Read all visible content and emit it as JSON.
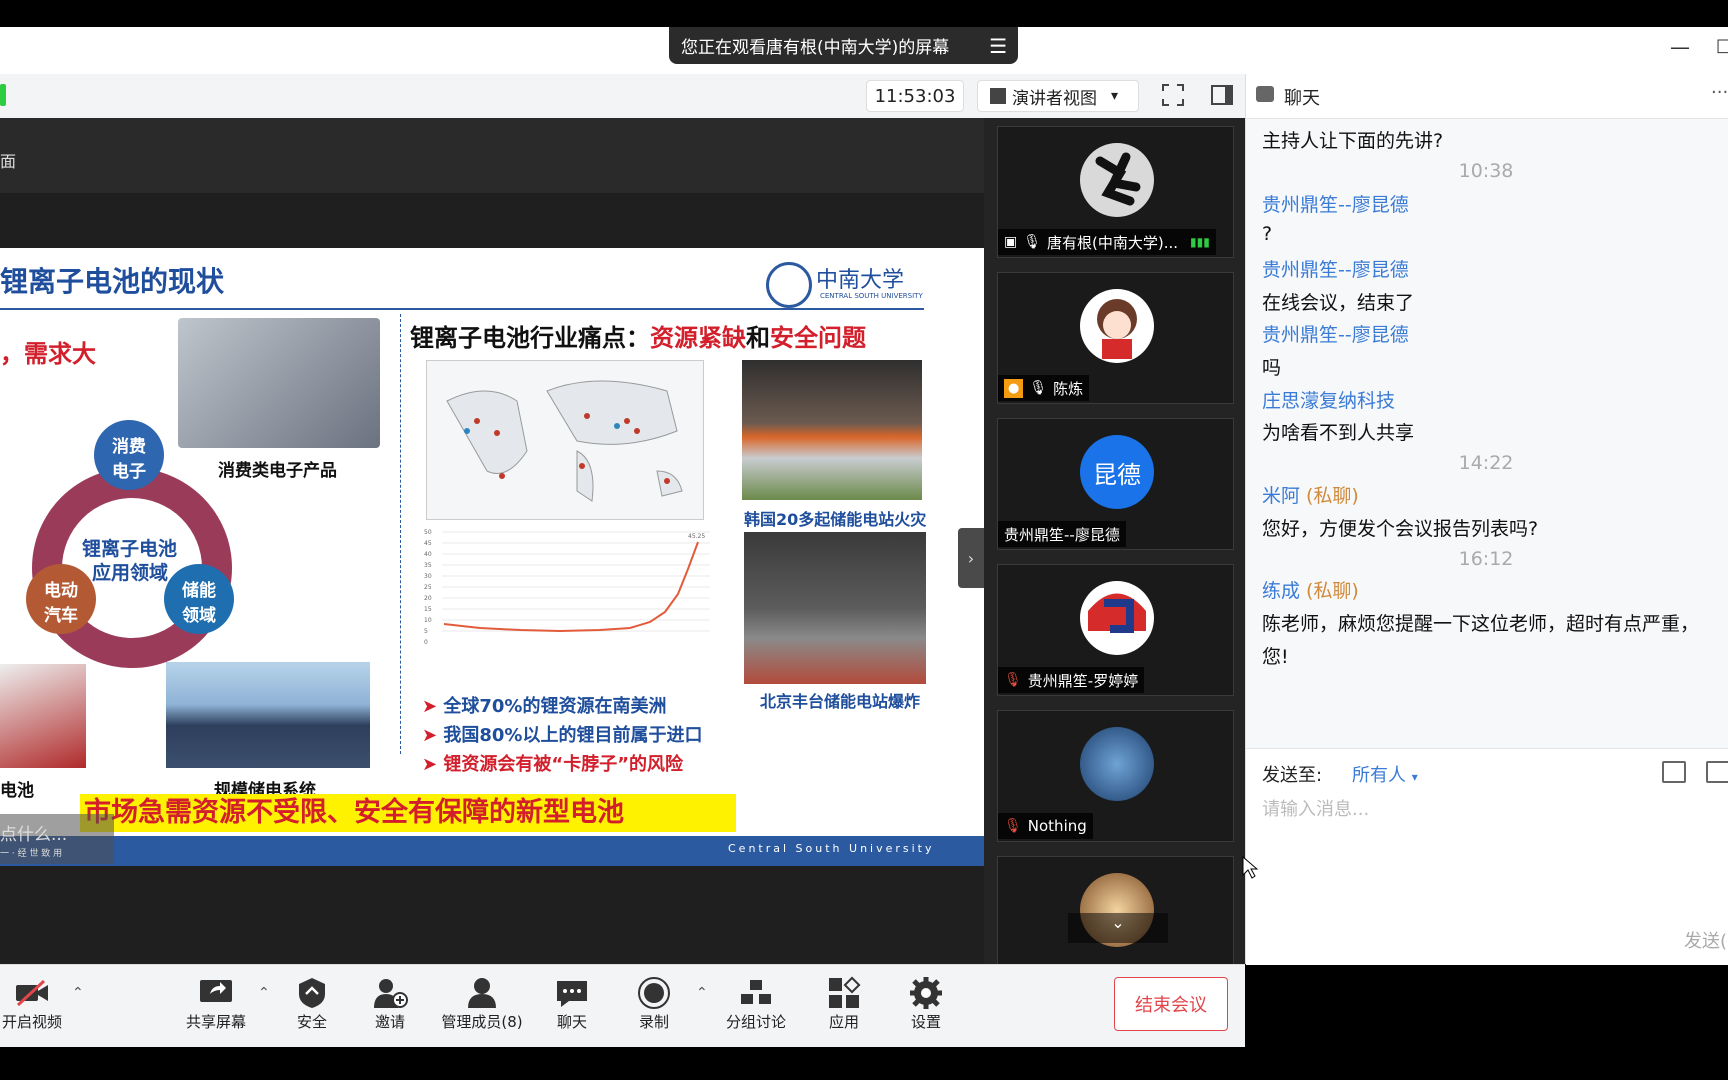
{
  "window": {
    "banner_text": "您正在观看唐有根(中南大学)的屏幕",
    "banner_menu": "☰",
    "minimize": "—",
    "maximize": "□"
  },
  "toolbar": {
    "clock": "11:53:03",
    "view_mode": "演讲者视图",
    "dropdown": "▾"
  },
  "chat_header": {
    "title": "聊天",
    "more": "···"
  },
  "slide": {
    "corner_label": "面",
    "title": "锂离子电池的现状",
    "univ_cn": "中南大学",
    "univ_en": "CENTRAL SOUTH UNIVERSITY",
    "left_sub": "，需求大",
    "consumer_label": "消费类电子产品",
    "circle_center_1": "锂离子电池",
    "circle_center_2": "应用领域",
    "node_consumer_1": "消费",
    "node_consumer_2": "电子",
    "node_ev_1": "电动",
    "node_ev_2": "汽车",
    "node_storage_1": "储能",
    "node_storage_2": "领域",
    "right_heading_prefix": "锂离子电池行业痛点：",
    "right_heading_red1": "资源紧缺",
    "right_heading_mid": "和",
    "right_heading_red2": "安全问题",
    "fire1_caption": "韩国20多起储能电站火灾",
    "fire2_caption": "北京丰台储能电站爆炸",
    "bullets": [
      "全球70%的锂资源在南美洲",
      "我国80%以上的锂目前属于进口",
      "锂资源会有被“卡脖子”的风险"
    ],
    "ev_label": "电池",
    "grid_label": "规模储电系统",
    "banner": "市场急需资源不受限、安全有保障的新型电池",
    "footer": "Central South University",
    "overlay_text": "点什么...",
    "overlay_sub": "一 · 经 世 致 用",
    "chart_peak_label": "45.25",
    "chart_y_ticks": [
      "50",
      "45",
      "40",
      "35",
      "30",
      "25",
      "20",
      "15",
      "10",
      "5",
      "0"
    ]
  },
  "participants": [
    {
      "name": "唐有根(中南大学)...",
      "avatar_text": ""
    },
    {
      "name": "陈炼",
      "avatar_text": ""
    },
    {
      "name": "贵州鼎笙--廖昆德",
      "avatar_text": "昆德"
    },
    {
      "name": "贵州鼎笙-罗婷婷",
      "avatar_text": ""
    },
    {
      "name": "Nothing",
      "avatar_text": ""
    },
    {
      "name": "",
      "avatar_text": ""
    }
  ],
  "chat": {
    "messages": [
      {
        "type": "msg",
        "text": "主持人让下面的先讲?"
      },
      {
        "type": "time",
        "text": "10:38"
      },
      {
        "type": "sender",
        "text": "贵州鼎笙--廖昆德"
      },
      {
        "type": "msg",
        "text": "?"
      },
      {
        "type": "sender",
        "text": "贵州鼎笙--廖昆德"
      },
      {
        "type": "msg",
        "text": "在线会议，结束了"
      },
      {
        "type": "sender",
        "text": "贵州鼎笙--廖昆德"
      },
      {
        "type": "msg",
        "text": "吗"
      },
      {
        "type": "sender",
        "text": "庄思濛复纳科技"
      },
      {
        "type": "msg",
        "text": "为啥看不到人共享"
      },
      {
        "type": "time",
        "text": "14:22"
      },
      {
        "type": "sender",
        "text": "米阿",
        "private": "(私聊)"
      },
      {
        "type": "msg",
        "text": "您好，方便发个会议报告列表吗?"
      },
      {
        "type": "time",
        "text": "16:12"
      },
      {
        "type": "sender",
        "text": "练成",
        "private": "(私聊)"
      },
      {
        "type": "msg",
        "text": "陈老师，麻烦您提醒一下这位老师，超时有点严重，"
      },
      {
        "type": "msg",
        "text": "您!"
      }
    ],
    "send_to_label": "发送至:",
    "send_to_value": "所有人",
    "input_placeholder": "请输入消息...",
    "send_button": "发送("
  },
  "bottom": {
    "video": "开启视频",
    "share": "共享屏幕",
    "security": "安全",
    "invite": "邀请",
    "members": "管理成员(8)",
    "chat": "聊天",
    "record": "录制",
    "breakout": "分组讨论",
    "apps": "应用",
    "settings": "设置",
    "end": "结束会议"
  },
  "colors": {
    "accent": "#3a7bd5",
    "end_red": "#e0464a",
    "slide_blue": "#1f4e9c",
    "slide_red": "#d21f2b"
  }
}
